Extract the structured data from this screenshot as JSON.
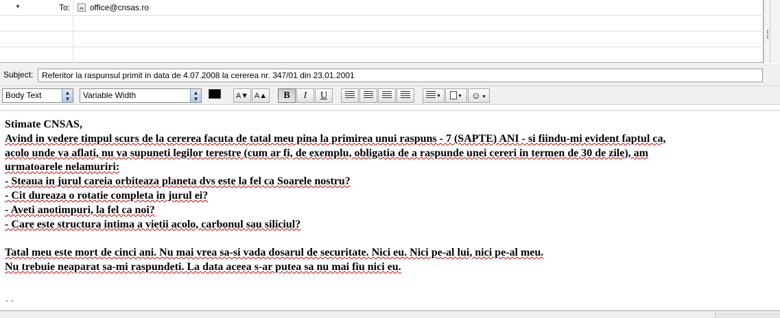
{
  "address": {
    "rows": [
      {
        "label": "To:",
        "value": "office@cnsas.ro"
      },
      {
        "label": "",
        "value": ""
      },
      {
        "label": "",
        "value": ""
      }
    ]
  },
  "subject": {
    "label": "Subject:",
    "value": "Referitor la raspunsul primit in data de 4.07.2008 la cererea nr. 347/01 din 23.01.2001"
  },
  "toolbar": {
    "paragraph_format": "Body Text",
    "font": "Variable Width",
    "text_color": "#000000",
    "background_color": "#ffffff",
    "smaller_font": "A▼",
    "larger_font": "A▲",
    "bold": "B",
    "italic": "I",
    "underline": "U",
    "emoticon": "☺"
  },
  "message": {
    "greeting": "Stimate CNSAS,",
    "lines": [
      "Avind in vedere timpul scurs de la cererea facuta de tatal meu pina la primirea unui raspuns - 7 (SAPTE) ANI - si fiindu-mi evident faptul ca,",
      "acolo unde va aflati, nu va supuneti legilor terestre (cum ar fi, de exemplu, obligatia de a raspunde unei cereri in termen de 30 de zile), am",
      "urmatoarele nelamuriri:",
      "- Steaua in jurul careia orbiteaza planeta dvs este la fel ca Soarele nostru?",
      "- Cit dureaza o rotatie completa in jurul ei?",
      "- Aveti anotimpuri, la fel ca noi?",
      "- Care este structura intima a vietii acolo, carbonul sau siliciul?",
      "",
      "Tatal meu este mort de cinci ani. Nu mai vrea sa-si vada dosarul de securitate. Nici eu. Nici pe-al lui, nici pe-al meu.",
      "Nu trebuie neaparat sa-mi raspundeti. La data aceea s-ar putea sa nu mai fiu nici eu."
    ],
    "signature_separator": "--"
  }
}
